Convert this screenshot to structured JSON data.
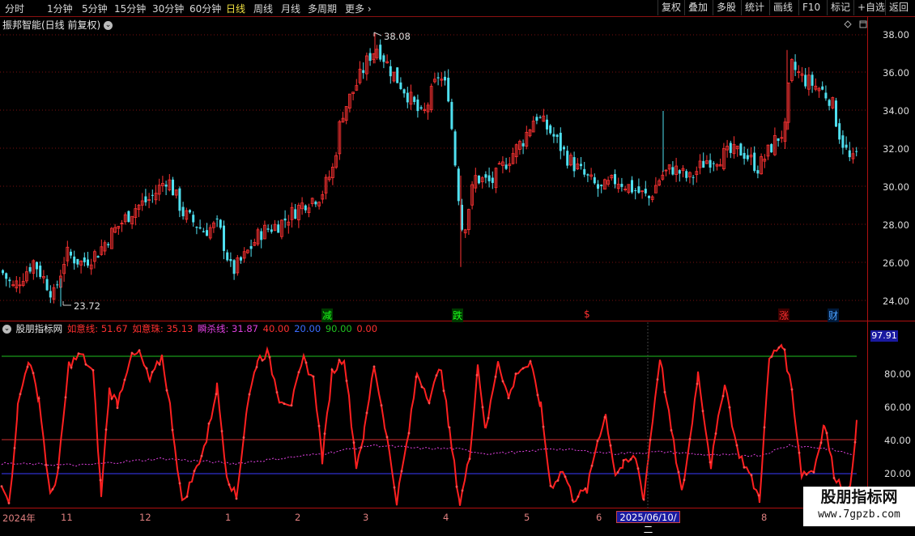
{
  "periods": [
    "分时",
    "1分钟",
    "5分钟",
    "15分钟",
    "30分钟",
    "60分钟",
    "日线",
    "周线",
    "月线",
    "多周期",
    "更多"
  ],
  "periods_active": "日线",
  "tools": [
    "复权",
    "叠加",
    "多股",
    "统计",
    "画线",
    "F10",
    "标记",
    "+自选",
    "返回"
  ],
  "kline": {
    "title": "振邦智能(日线 前复权)",
    "price_axis": [
      "38.00",
      "36.00",
      "34.00",
      "32.00",
      "30.00",
      "28.00",
      "26.00",
      "24.00"
    ],
    "high_label": "38.08",
    "low_label": "23.72",
    "events": [
      {
        "text": "减",
        "color": "#1aff1a",
        "bg": "#003a00"
      },
      {
        "text": "跌",
        "color": "#1aff1a",
        "bg": "#003a00"
      },
      {
        "text": "$",
        "color": "#ff3030",
        "bg": "#000"
      },
      {
        "text": "涨",
        "color": "#ff3030",
        "bg": "#3a0000"
      },
      {
        "text": "财",
        "color": "#4aa0ff",
        "bg": "#001a3a"
      }
    ]
  },
  "indicator": {
    "name": "股朋指标网",
    "legend": [
      {
        "text": "如意线: 51.67",
        "color": "#ff3030"
      },
      {
        "text": "如意珠: 35.13",
        "color": "#ff3030"
      },
      {
        "text": "瞬杀线: 31.87",
        "color": "#e040e0"
      },
      {
        "text": "40.00",
        "color": "#ff3030"
      },
      {
        "text": "20.00",
        "color": "#3a6cff"
      },
      {
        "text": "90.00",
        "color": "#20c020"
      },
      {
        "text": "0.00",
        "color": "#ff3030"
      }
    ],
    "axis": [
      "80.00",
      "60.00",
      "40.00",
      "20.00"
    ],
    "current_value": "97.91"
  },
  "dates": {
    "labels": [
      "2024年",
      "11",
      "12",
      "1",
      "2",
      "3",
      "4",
      "5",
      "6",
      "8"
    ],
    "cursor": "2025/06/10/二"
  },
  "watermark": {
    "title": "股朋指标网",
    "url": "www.7gpzb.com"
  },
  "colors": {
    "up": "#ff3333",
    "down": "#4fe0f0",
    "grid": "#8b1010",
    "line90": "#20c020",
    "line40": "#ff3030",
    "line20": "#3a3aff"
  }
}
